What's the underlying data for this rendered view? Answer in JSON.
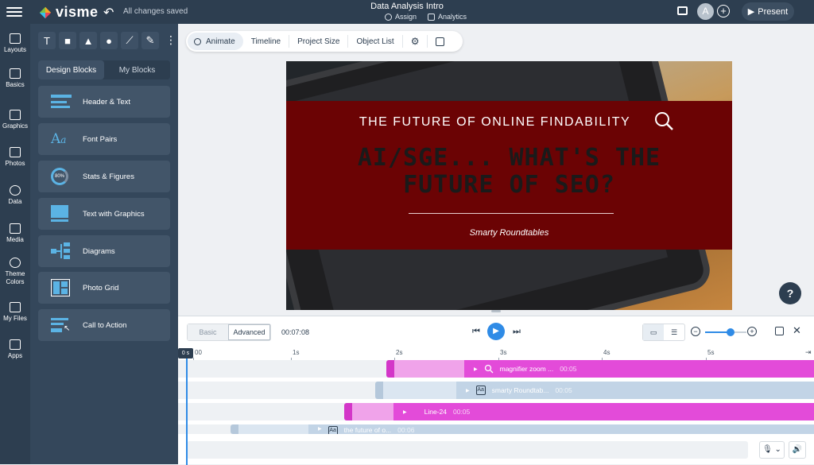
{
  "app": {
    "logo_text": "visme",
    "save_status": "All changes saved",
    "doc_title": "Data Analysis Intro",
    "assign_label": "Assign",
    "analytics_label": "Analytics",
    "avatar_initial": "A",
    "present_label": "Present"
  },
  "rail": [
    {
      "label": "Layouts"
    },
    {
      "label": "Basics"
    },
    {
      "label": "Graphics"
    },
    {
      "label": "Photos"
    },
    {
      "label": "Data"
    },
    {
      "label": "Media"
    },
    {
      "label": "Theme Colors"
    },
    {
      "label": "My Files"
    },
    {
      "label": "Apps"
    }
  ],
  "panel": {
    "tools": [
      "T",
      "■",
      "▲",
      "●",
      "⟋",
      "✎"
    ],
    "tabs": [
      "Design Blocks",
      "My Blocks"
    ],
    "blocks": [
      {
        "label": "Header & Text",
        "icon": "header-text-icon"
      },
      {
        "label": "Font Pairs",
        "icon": "font-pairs-icon"
      },
      {
        "label": "Stats & Figures",
        "icon": "stats-icon"
      },
      {
        "label": "Text with Graphics",
        "icon": "text-graphics-icon"
      },
      {
        "label": "Diagrams",
        "icon": "diagram-icon"
      },
      {
        "label": "Photo Grid",
        "icon": "photo-grid-icon"
      },
      {
        "label": "Call to Action",
        "icon": "call-to-action-icon"
      }
    ],
    "stats_icon_text": "80%"
  },
  "toolbar": {
    "animate": "Animate",
    "timeline": "Timeline",
    "project_size": "Project Size",
    "object_list": "Object List"
  },
  "slide": {
    "subtitle": "THE FUTURE OF ONLINE FINDABILITY",
    "headline_line1": "AI/SGE... WHAT'S THE",
    "headline_line2": "FUTURE OF SEO?",
    "author": "Smarty Roundtables",
    "banner_color": "#6b0304"
  },
  "help_label": "?",
  "timeline": {
    "modes": [
      "Basic",
      "Advanced"
    ],
    "total_time": "00:07:08",
    "playhead_label": "0 s",
    "zoom_fraction": 0.62,
    "ruler": [
      "00",
      "1s",
      "2s",
      "3s",
      "4s",
      "5s"
    ],
    "tracks": [
      {
        "name": "magnifier zoom ...",
        "duration": "00:05",
        "color": "#e34bd9"
      },
      {
        "name": "smarty Roundtab...",
        "duration": "00:05",
        "color": "#c2d4e6"
      },
      {
        "name": "Line-24",
        "duration": "00:05",
        "color": "#e34bd9"
      },
      {
        "name": "the future of o...",
        "duration": "00:06",
        "color": "#c2d4e6"
      }
    ]
  }
}
